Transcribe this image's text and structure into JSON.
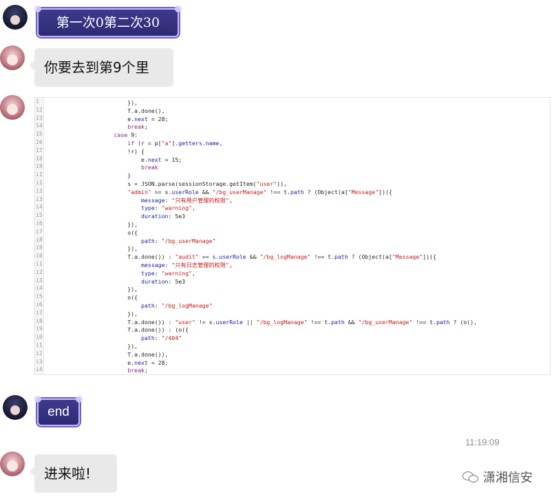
{
  "messages": {
    "m1": {
      "text": "第一次0第二次30"
    },
    "m2": {
      "text": "你要去到第9个里"
    },
    "m3": {
      "gutter": [
        "1",
        "12",
        "13",
        "14",
        "15",
        "16",
        "17",
        "18",
        "19",
        "i1",
        "i1",
        "i2",
        "i3",
        "i4",
        "i5",
        "i6",
        "i7",
        "i8",
        "i9",
        "i0",
        "i1",
        "i2",
        "i3",
        "i4",
        "i5",
        "i6",
        "i7",
        "i8",
        "i9",
        "i0",
        "i1",
        "i2",
        "i3",
        "i4"
      ],
      "lines": [
        "                        }),",
        "                        T.a.done(),",
        "                        e.next = 28;",
        "                        break;",
        "                    case 9:",
        "                        if (r = p[\"a\"].getters.name,",
        "                        !r) {",
        "                            e.next = 15;",
        "                            break",
        "                        }",
        "                        s = JSON.parse(sessionStorage.getItem(\"user\")),",
        "                        \"admin\" == s.userRole && \"/bg_userManage\" !== t.path ? (Object(a[\"Message\"])({",
        "                            message: \"只有用户管理的权限\",",
        "                            type: \"warning\",",
        "                            duration: 5e3",
        "                        }),",
        "                        o({",
        "                            path: \"/bg_userManage\"",
        "                        }),",
        "                        T.a.done()) : \"audit\" == s.userRole && \"/bg_logManage\" !== t.path ? (Object(a[\"Message\"])({",
        "                            message: \"只有日志管理的权限\",",
        "                            type: \"warning\",",
        "                            duration: 5e3",
        "                        }),",
        "                        o({",
        "                            path: \"/bg_logManage\"",
        "                        }),",
        "                        T.a.done()) : \"user\" != s.userRole || \"/bg_logManage\" !== t.path && \"/bg_userManage\" !== t.path ? (o(),",
        "                        T.a.done()) : (o({",
        "                            path: \"/404\"",
        "                        }),",
        "                        T.a.done()),",
        "                        e.next = 28;",
        "                        break;"
      ]
    },
    "m4": {
      "text": "end"
    },
    "time": "11:19:09",
    "m5": {
      "text": "进来啦!"
    }
  },
  "watermark": {
    "text": "潇湘信安",
    "icon": "wechat-icon"
  }
}
